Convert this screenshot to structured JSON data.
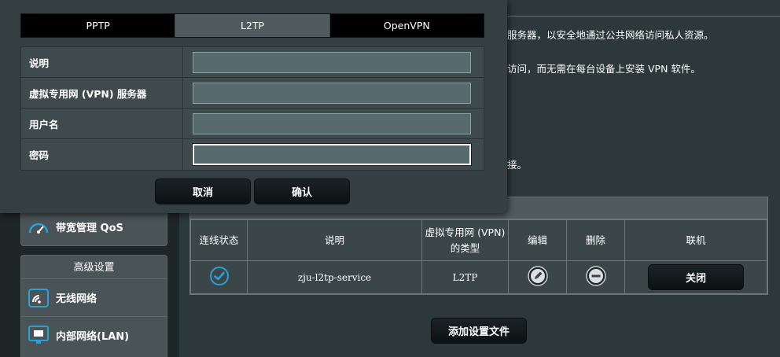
{
  "sidebar": {
    "qos_label": "带宽管理 QoS",
    "advanced_header": "高级设置",
    "items": [
      {
        "label": "无线网络",
        "icon": "wifi-icon"
      },
      {
        "label": "内部网络(LAN)",
        "icon": "lan-icon"
      }
    ]
  },
  "main": {
    "desc_line1": "服务器，以安全地通过公共网络访问私人资源。",
    "desc_line2": "访问，而无需在每台设备上安装 VPN 软件。",
    "desc_line3": "接。",
    "table": {
      "headers": [
        "连线状态",
        "说明",
        "虚拟专用网 (VPN)\n的类型",
        "编辑",
        "删除",
        "联机"
      ],
      "rows": [
        {
          "description": "zju-l2tp-service",
          "type": "L2TP",
          "connect_label": "关闭"
        }
      ]
    },
    "add_profile_label": "添加设置文件"
  },
  "modal": {
    "tabs": [
      "PPTP",
      "L2TP",
      "OpenVPN"
    ],
    "active_tab": "L2TP",
    "fields": [
      {
        "label": "说明",
        "value": ""
      },
      {
        "label": "虚拟专用网 (VPN) 服务器",
        "value": ""
      },
      {
        "label": "用户名",
        "value": ""
      },
      {
        "label": "密码",
        "value": ""
      }
    ],
    "cancel_label": "取消",
    "confirm_label": "确认"
  },
  "colors": {
    "accent_blue": "#2a9fd8",
    "background": "#2d383b",
    "button_dark": "#0c1113"
  }
}
